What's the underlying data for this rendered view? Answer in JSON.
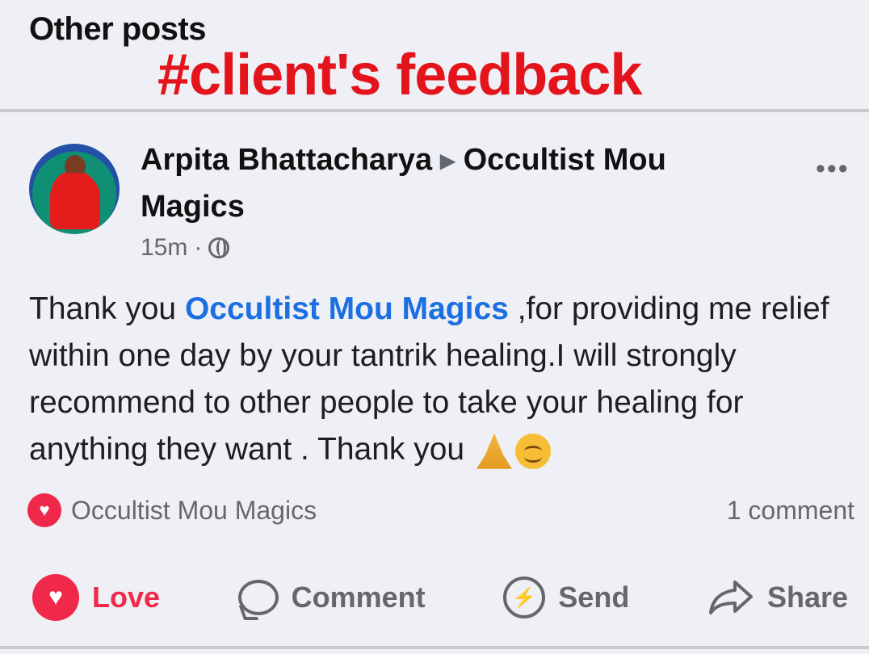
{
  "page": {
    "section_title": "Other posts",
    "overlay_tag": "#client's feedback"
  },
  "post": {
    "author": "Arpita Bhattacharya",
    "target_page": "Occultist Mou Magics",
    "time": "15m",
    "separator": "·",
    "privacy_icon": "globe-icon",
    "more_icon": "•••",
    "body": {
      "before_mention": "Thank you ",
      "mention": "Occultist Mou Magics",
      "after_mention": " ,for providing me relief within one day by your tantrik healing.I will strongly recommend to other people to take your healing for anything they want . Thank you "
    },
    "reactions": {
      "icon": "heart-icon",
      "reactor": "Occultist Mou Magics",
      "comment_count": "1 comment"
    },
    "actions": {
      "love": "Love",
      "comment": "Comment",
      "send": "Send",
      "share": "Share"
    }
  },
  "colors": {
    "overlay_red": "#e3141b",
    "mention_blue": "#1b6fe0",
    "love_red": "#f0284a",
    "muted_gray": "#65676b"
  }
}
